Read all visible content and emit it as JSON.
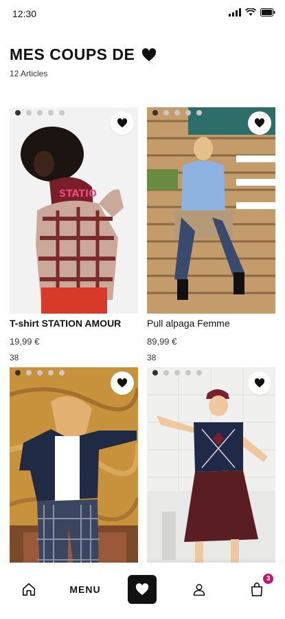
{
  "status_bar": {
    "time": "12:30",
    "icons": [
      "signal-icon",
      "wifi-icon",
      "battery-icon"
    ]
  },
  "header": {
    "title": "MES COUPS DE",
    "title_icon": "heart-icon",
    "article_count": "12 Articles"
  },
  "products": [
    {
      "name": "T-shirt STATION AMOUR",
      "price": "19,99 €",
      "size": "38",
      "active_dot": 0,
      "dots": 5
    },
    {
      "name": "Pull alpaga Femme",
      "price": "89,99 €",
      "size": "38",
      "active_dot": 0,
      "dots": 5
    },
    {
      "name": "",
      "price": "",
      "size": "",
      "active_dot": 0,
      "dots": 5
    },
    {
      "name": "",
      "price": "",
      "size": "",
      "active_dot": 0,
      "dots": 5
    }
  ],
  "bottom_nav": {
    "home_icon": "home-icon",
    "menu_label": "MENU",
    "favorites_icon": "heart-icon",
    "account_icon": "user-icon",
    "cart_icon": "shopping-bag-icon",
    "cart_count": "3"
  },
  "colors": {
    "accent": "#111111",
    "badge": "#c2186b"
  }
}
